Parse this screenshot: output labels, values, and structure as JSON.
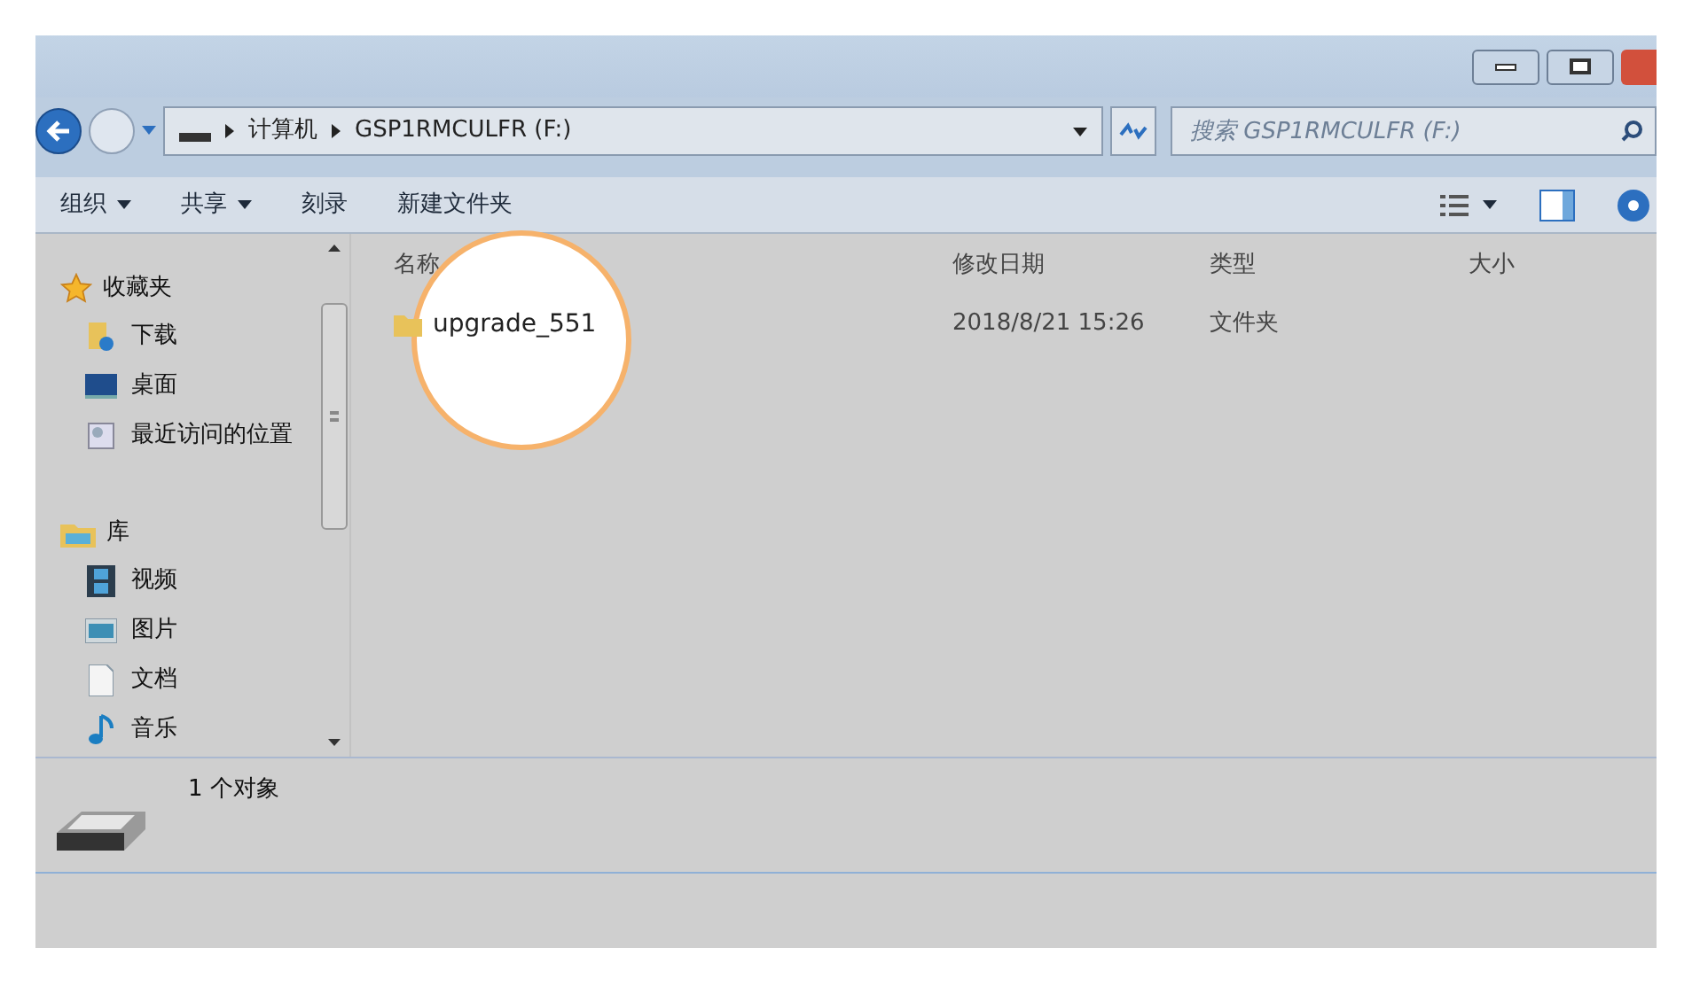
{
  "address": {
    "segments": [
      "计算机",
      "GSP1RMCULFR (F:)"
    ]
  },
  "search": {
    "placeholder": "搜索 GSP1RMCULFR (F:)"
  },
  "toolbar": [
    {
      "label": "组织",
      "dropdown": true
    },
    {
      "label": "共享",
      "dropdown": true
    },
    {
      "label": "刻录",
      "dropdown": false
    },
    {
      "label": "新建文件夹",
      "dropdown": false
    }
  ],
  "sidebar": {
    "groups": [
      {
        "label": "收藏夹",
        "kind": "star",
        "children": [
          {
            "label": "下载",
            "kind": "download"
          },
          {
            "label": "桌面",
            "kind": "desktop"
          },
          {
            "label": "最近访问的位置",
            "kind": "recent"
          }
        ]
      },
      {
        "label": "库",
        "kind": "library",
        "children": [
          {
            "label": "视频",
            "kind": "video"
          },
          {
            "label": "图片",
            "kind": "picture"
          },
          {
            "label": "文档",
            "kind": "document"
          },
          {
            "label": "音乐",
            "kind": "music"
          }
        ]
      }
    ]
  },
  "table": {
    "columns": [
      "名称",
      "修改日期",
      "类型",
      "大小"
    ],
    "rows": [
      {
        "name": "upgrade_551",
        "modified": "2018/8/21 15:26",
        "type": "文件夹",
        "highlighted": true
      }
    ]
  },
  "details": {
    "count": "1 个对象"
  }
}
